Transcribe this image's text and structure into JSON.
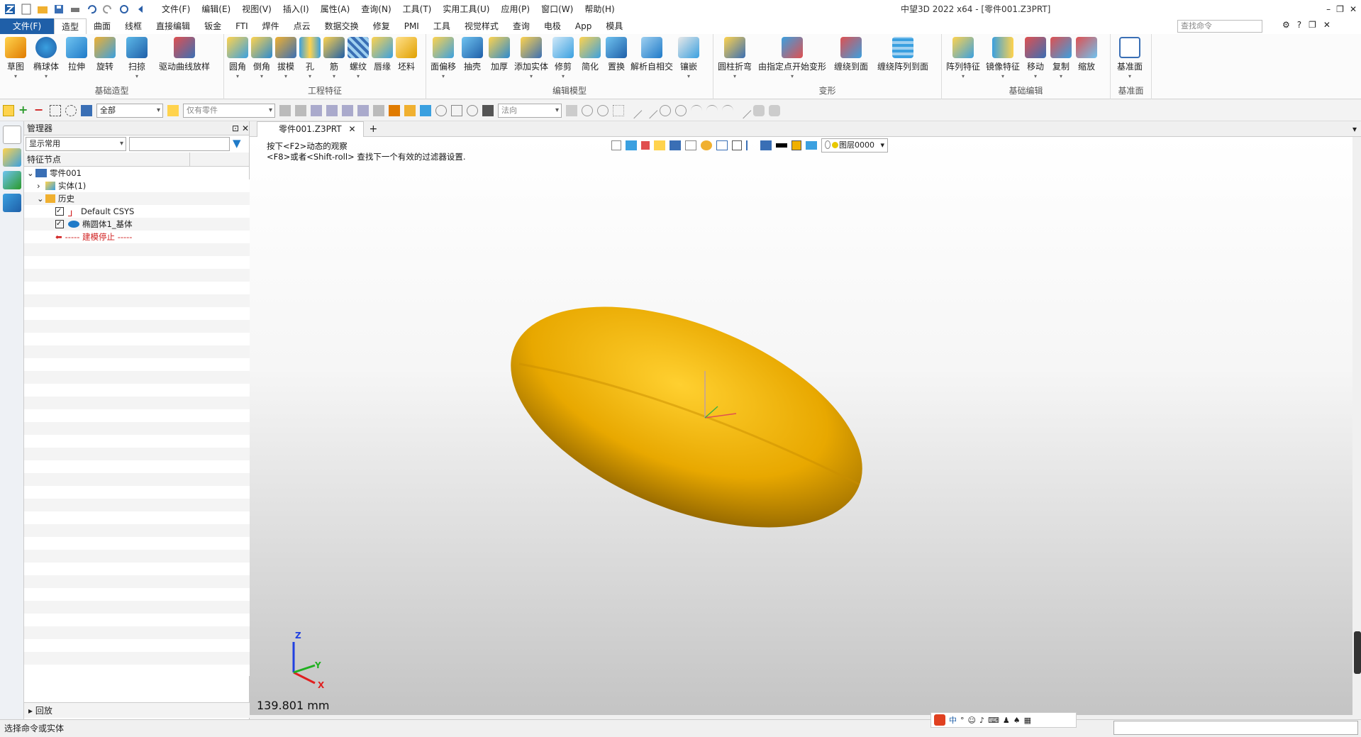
{
  "menus": [
    "文件(F)",
    "编辑(E)",
    "视图(V)",
    "插入(I)",
    "属性(A)",
    "查询(N)",
    "工具(T)",
    "实用工具(U)",
    "应用(P)",
    "窗口(W)",
    "帮助(H)"
  ],
  "app_title": "中望3D 2022 x64 - [零件001.Z3PRT]",
  "file_tab": "文件(F)",
  "tabs": [
    "造型",
    "曲面",
    "线框",
    "直接编辑",
    "钣金",
    "FTI",
    "焊件",
    "点云",
    "数据交换",
    "修复",
    "PMI",
    "工具",
    "视觉样式",
    "查询",
    "电极",
    "App",
    "模具"
  ],
  "search_placeholder": "查找命令",
  "ribbon_groups": [
    {
      "name": "基础造型",
      "buttons": [
        "草图",
        "椭球体",
        "拉伸",
        "旋转",
        "扫掠",
        "驱动曲线放样"
      ]
    },
    {
      "name": "工程特征",
      "buttons": [
        "圆角",
        "倒角",
        "拔模",
        "孔",
        "筋",
        "螺纹",
        "唇缘",
        "坯料"
      ]
    },
    {
      "name": "编辑模型",
      "buttons": [
        "面偏移",
        "抽壳",
        "加厚",
        "添加实体",
        "修剪",
        "简化",
        "置换",
        "解析自相交",
        "镶嵌"
      ]
    },
    {
      "name": "变形",
      "buttons": [
        "圆柱折弯",
        "由指定点开始变形",
        "缠绕到面",
        "缠绕阵列到面"
      ]
    },
    {
      "name": "基础编辑",
      "buttons": [
        "阵列特征",
        "镜像特征",
        "移动",
        "复制",
        "缩放"
      ]
    },
    {
      "name": "基准面",
      "buttons": [
        "基准面"
      ]
    }
  ],
  "toolbar2": {
    "filter_all": "全部",
    "filter_part": "仅有零件",
    "normal": "法向"
  },
  "panel": {
    "title": "管理器",
    "display_filter": "显示常用",
    "column": "特征节点",
    "tree": [
      {
        "label": "零件001",
        "level": 0
      },
      {
        "label": "实体(1)",
        "level": 1
      },
      {
        "label": "历史",
        "level": 1
      },
      {
        "label": "Default CSYS",
        "level": 2
      },
      {
        "label": "椭圆体1_基体",
        "level": 2
      },
      {
        "label": "----- 建模停止 -----",
        "level": 2
      }
    ],
    "rollback": "回放"
  },
  "doc_tab": "零件001.Z3PRT",
  "hints": [
    "按下<F2>动态的观察",
    "<F8>或者<Shift-roll> 查找下一个有效的过滤器设置."
  ],
  "layer": "图层0000",
  "scale": "139.801 mm",
  "axes": {
    "x": "X",
    "y": "Y",
    "z": "Z"
  },
  "status": "选择命令或实体",
  "colors": {
    "accent": "#1f5fa8",
    "body": "#e8a800"
  }
}
